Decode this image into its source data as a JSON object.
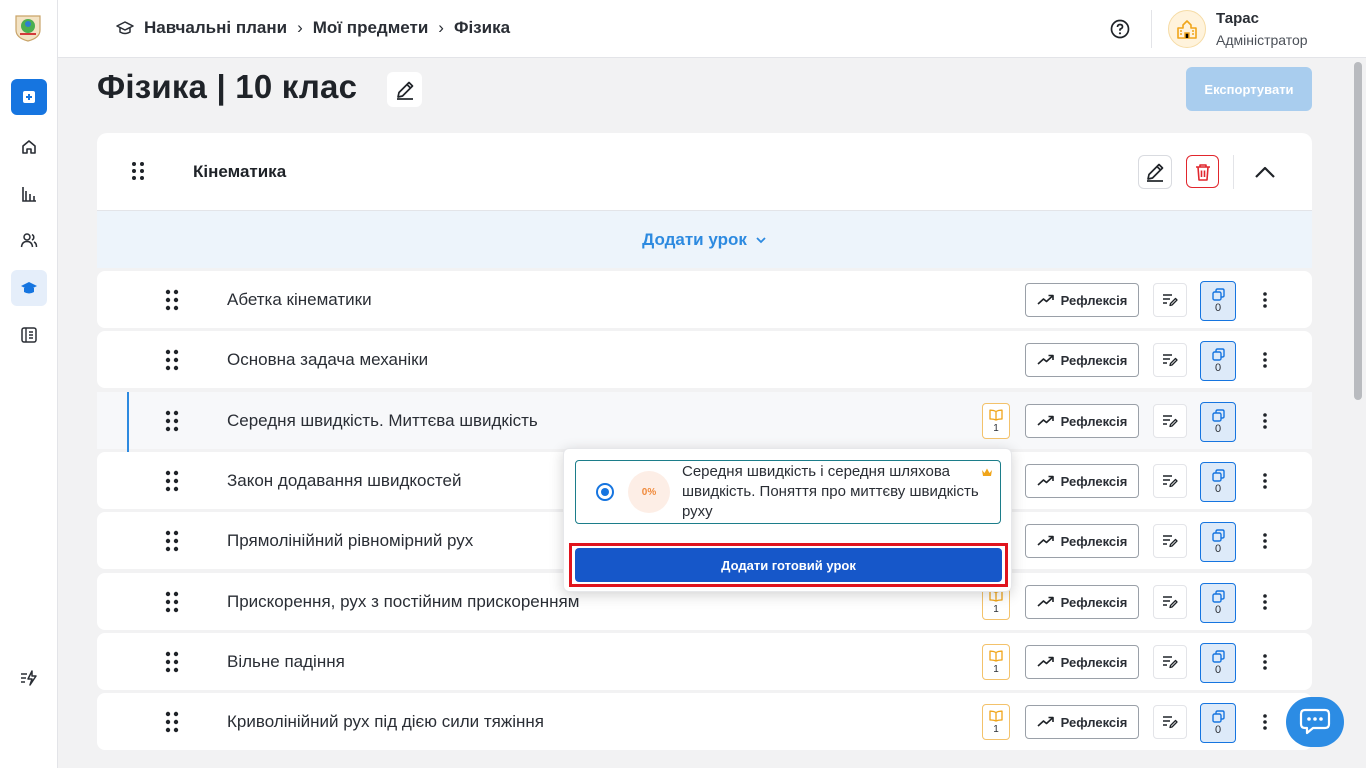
{
  "breadcrumb": [
    "Навчальні плани",
    "Мої предмети",
    "Фізика"
  ],
  "user": {
    "name": "Тарас",
    "role": "Адміністратор"
  },
  "page": {
    "title": "Фізика | 10 клас",
    "export_label": "Експортувати"
  },
  "module": {
    "title": "Кінематика"
  },
  "add_lesson_label": "Додати урок",
  "lessons": [
    {
      "name": "Абетка кінематики",
      "reflection": "Рефлексія",
      "copies": "0"
    },
    {
      "name": "Основна задача механіки",
      "reflection": "Рефлексія",
      "copies": "0"
    },
    {
      "name": "Середня швидкість. Миттєва швидкість",
      "book": "1",
      "reflection": "Рефлексія",
      "copies": "0"
    },
    {
      "name": "Закон додавання швидкостей",
      "reflection": "Рефлексія",
      "copies": "0"
    },
    {
      "name": "Прямолінійний рівномірний рух",
      "reflection": "Рефлексія",
      "copies": "0"
    },
    {
      "name": "Прискорення, рух з постійним прискоренням",
      "book": "1",
      "reflection": "Рефлексія",
      "copies": "0"
    },
    {
      "name": "Вільне падіння",
      "book": "1",
      "reflection": "Рефлексія",
      "copies": "0"
    },
    {
      "name": "Криволінійний рух під дією сили тяжіння",
      "book": "1",
      "reflection": "Рефлексія",
      "copies": "0"
    }
  ],
  "popup": {
    "option_progress": "0%",
    "option_text": "Середня швидкість і середня шляхова швидкість. Поняття про миттєву швидкість руху",
    "add_ready_label": "Додати готовий урок"
  },
  "colors": {
    "primary": "#1675e0",
    "accent_blue": "#2d8ae0",
    "danger": "#e1262d",
    "ready_button": "#1657c9"
  }
}
